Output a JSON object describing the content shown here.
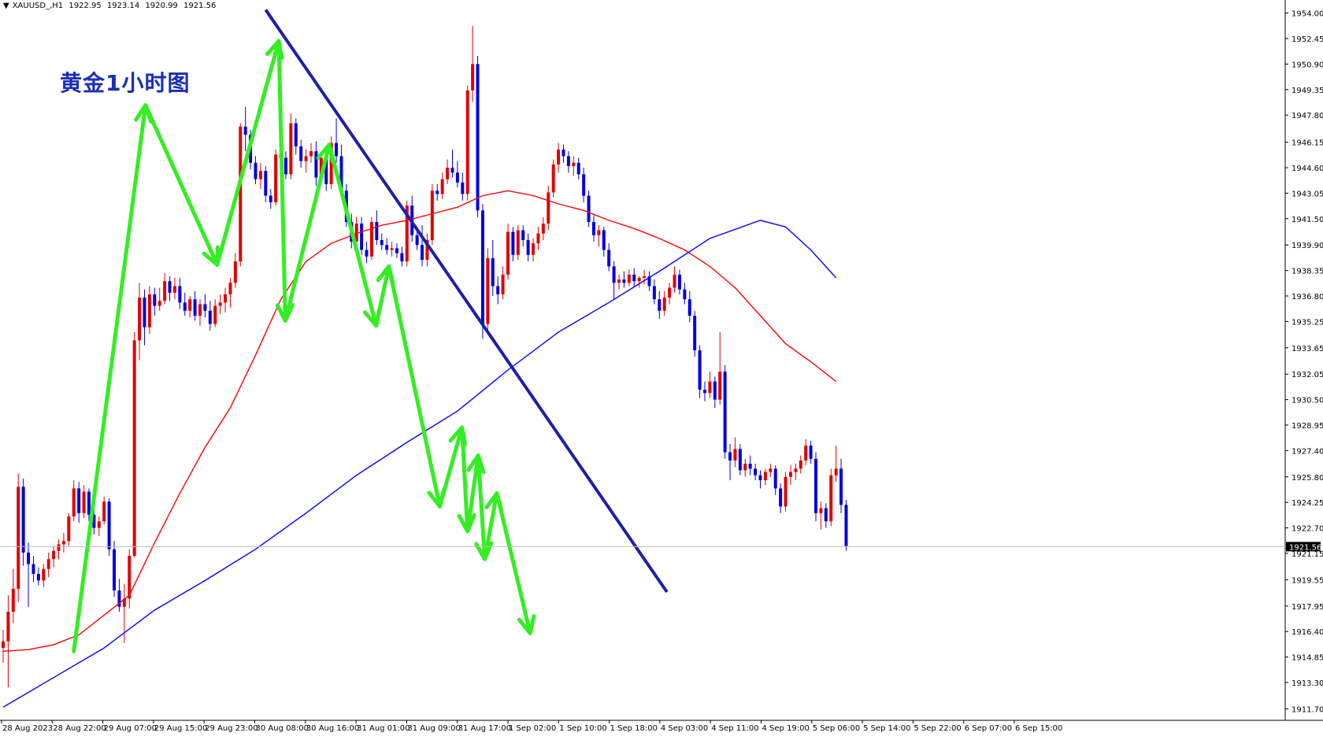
{
  "info_bar": {
    "symbol_timeframe": "XAUUSD_,H1",
    "open": "1922.95",
    "high": "1923.14",
    "low": "1920.99",
    "close": "1921.56"
  },
  "title": "黄金1小时图",
  "colors": {
    "bull_candle": "#e00000",
    "bear_candle": "#0000e0",
    "ma_fast": "#ff0000",
    "ma_slow": "#0000ff",
    "trendline": "#1f1faa",
    "arrows": "#33ee22"
  },
  "price_axis": {
    "ticks": [
      "1954.00",
      "1952.45",
      "1950.90",
      "1949.35",
      "1947.80",
      "1946.15",
      "1944.60",
      "1943.05",
      "1941.50",
      "1939.90",
      "1938.35",
      "1936.80",
      "1935.25",
      "1933.65",
      "1932.05",
      "1930.50",
      "1928.95",
      "1927.40",
      "1925.80",
      "1924.25",
      "1922.70",
      "1921.15",
      "1919.55",
      "1917.95",
      "1916.40",
      "1914.85",
      "1913.30",
      "1911.70"
    ],
    "current_price": "1921.56"
  },
  "time_axis": {
    "labels": [
      "28 Aug 2023",
      "28 Aug 22:00",
      "29 Aug 07:00",
      "29 Aug 15:00",
      "29 Aug 23:00",
      "30 Aug 08:00",
      "30 Aug 16:00",
      "31 Aug 01:00",
      "31 Aug 09:00",
      "31 Aug 17:00",
      "1 Sep 02:00",
      "1 Sep 10:00",
      "1 Sep 18:00",
      "4 Sep 03:00",
      "4 Sep 11:00",
      "4 Sep 19:00",
      "5 Sep 06:00",
      "5 Sep 14:00",
      "5 Sep 22:00",
      "6 Sep 07:00",
      "6 Sep 15:00"
    ]
  },
  "chart_data": {
    "type": "candlestick",
    "symbol": "XAUUSD_",
    "timeframe": "H1",
    "ylim": [
      1911.0,
      1954.7
    ],
    "grid": false,
    "candles": [
      [
        1915.4,
        1916.5,
        1914.5,
        1915.8
      ],
      [
        1915.8,
        1918.6,
        1913.0,
        1917.6
      ],
      [
        1917.6,
        1920.2,
        1916.9,
        1919.0
      ],
      [
        1919.0,
        1926.0,
        1918.2,
        1925.2
      ],
      [
        1925.2,
        1925.7,
        1920.4,
        1921.2
      ],
      [
        1921.2,
        1921.8,
        1917.9,
        1920.5
      ],
      [
        1920.5,
        1921.0,
        1919.4,
        1919.9
      ],
      [
        1919.9,
        1920.3,
        1919.2,
        1919.5
      ],
      [
        1919.5,
        1920.5,
        1919.1,
        1920.2
      ],
      [
        1920.2,
        1921.2,
        1919.7,
        1920.8
      ],
      [
        1920.8,
        1921.6,
        1920.3,
        1921.3
      ],
      [
        1921.3,
        1922.0,
        1920.8,
        1921.7
      ],
      [
        1921.7,
        1922.4,
        1921.2,
        1921.9
      ],
      [
        1921.9,
        1923.6,
        1921.6,
        1923.4
      ],
      [
        1923.4,
        1925.6,
        1923.1,
        1925.1
      ],
      [
        1925.1,
        1925.5,
        1923.0,
        1923.6
      ],
      [
        1923.6,
        1925.3,
        1923.3,
        1924.9
      ],
      [
        1924.9,
        1925.1,
        1923.1,
        1923.5
      ],
      [
        1923.5,
        1923.9,
        1922.3,
        1922.7
      ],
      [
        1922.7,
        1923.4,
        1922.2,
        1923.1
      ],
      [
        1923.1,
        1924.6,
        1922.9,
        1924.3
      ],
      [
        1924.3,
        1924.5,
        1921.0,
        1921.4
      ],
      [
        1921.4,
        1921.9,
        1918.5,
        1918.9
      ],
      [
        1918.9,
        1919.6,
        1917.6,
        1917.9
      ],
      [
        1917.9,
        1919.3,
        1915.7,
        1918.4
      ],
      [
        1918.4,
        1921.4,
        1917.8,
        1921.0
      ],
      [
        1921.0,
        1934.6,
        1920.9,
        1934.1
      ],
      [
        1934.1,
        1937.6,
        1932.9,
        1936.7
      ],
      [
        1936.7,
        1937.2,
        1933.8,
        1934.9
      ],
      [
        1934.9,
        1937.4,
        1934.5,
        1936.9
      ],
      [
        1936.9,
        1937.3,
        1935.6,
        1936.2
      ],
      [
        1936.2,
        1937.3,
        1935.9,
        1936.5
      ],
      [
        1936.5,
        1938.2,
        1936.3,
        1937.7
      ],
      [
        1937.7,
        1938.0,
        1936.5,
        1937.0
      ],
      [
        1937.0,
        1937.9,
        1936.6,
        1937.4
      ],
      [
        1937.4,
        1937.9,
        1936.0,
        1936.4
      ],
      [
        1936.4,
        1937.0,
        1935.6,
        1935.9
      ],
      [
        1935.9,
        1936.8,
        1935.5,
        1936.6
      ],
      [
        1936.6,
        1937.1,
        1935.3,
        1935.6
      ],
      [
        1935.6,
        1936.6,
        1935.0,
        1936.3
      ],
      [
        1936.3,
        1936.9,
        1935.5,
        1935.9
      ],
      [
        1935.9,
        1936.5,
        1934.7,
        1935.1
      ],
      [
        1935.1,
        1936.6,
        1934.9,
        1936.2
      ],
      [
        1936.2,
        1936.9,
        1935.7,
        1936.4
      ],
      [
        1936.4,
        1937.3,
        1935.8,
        1936.9
      ],
      [
        1936.9,
        1937.9,
        1936.1,
        1937.6
      ],
      [
        1937.6,
        1939.4,
        1937.3,
        1938.9
      ],
      [
        1938.9,
        1947.3,
        1938.6,
        1947.1
      ],
      [
        1947.1,
        1948.3,
        1945.6,
        1946.6
      ],
      [
        1946.6,
        1946.9,
        1944.5,
        1944.9
      ],
      [
        1944.9,
        1945.3,
        1943.6,
        1943.9
      ],
      [
        1943.9,
        1944.9,
        1943.3,
        1944.4
      ],
      [
        1944.4,
        1944.7,
        1942.5,
        1942.9
      ],
      [
        1942.9,
        1943.3,
        1942.1,
        1942.5
      ],
      [
        1942.5,
        1945.7,
        1942.3,
        1945.4
      ],
      [
        1945.4,
        1946.0,
        1944.9,
        1945.2
      ],
      [
        1945.2,
        1945.6,
        1943.9,
        1944.2
      ],
      [
        1944.2,
        1947.9,
        1943.9,
        1947.3
      ],
      [
        1947.3,
        1947.6,
        1945.4,
        1945.9
      ],
      [
        1945.9,
        1946.3,
        1944.6,
        1945.0
      ],
      [
        1945.0,
        1945.7,
        1944.3,
        1945.3
      ],
      [
        1945.3,
        1946.1,
        1944.9,
        1945.6
      ],
      [
        1945.6,
        1946.2,
        1943.5,
        1944.0
      ],
      [
        1944.0,
        1945.6,
        1943.7,
        1945.2
      ],
      [
        1945.2,
        1945.6,
        1943.2,
        1943.6
      ],
      [
        1943.6,
        1946.5,
        1943.3,
        1946.1
      ],
      [
        1946.1,
        1947.6,
        1944.9,
        1945.3
      ],
      [
        1945.3,
        1946.0,
        1942.9,
        1943.2
      ],
      [
        1943.2,
        1943.6,
        1941.0,
        1941.3
      ],
      [
        1941.3,
        1941.8,
        1939.7,
        1940.1
      ],
      [
        1940.1,
        1941.6,
        1939.6,
        1941.2
      ],
      [
        1941.2,
        1941.6,
        1939.3,
        1939.6
      ],
      [
        1939.6,
        1940.1,
        1938.8,
        1939.2
      ],
      [
        1939.2,
        1941.6,
        1939.0,
        1941.3
      ],
      [
        1941.3,
        1942.0,
        1939.9,
        1940.2
      ],
      [
        1940.2,
        1940.6,
        1939.6,
        1939.9
      ],
      [
        1939.9,
        1940.3,
        1939.3,
        1939.6
      ],
      [
        1939.6,
        1940.1,
        1939.2,
        1939.7
      ],
      [
        1939.7,
        1940.0,
        1939.1,
        1939.4
      ],
      [
        1939.4,
        1939.8,
        1938.6,
        1938.9
      ],
      [
        1938.9,
        1942.6,
        1938.6,
        1942.3
      ],
      [
        1942.3,
        1942.9,
        1940.1,
        1940.5
      ],
      [
        1940.5,
        1941.0,
        1939.6,
        1939.9
      ],
      [
        1939.9,
        1941.1,
        1938.6,
        1939.0
      ],
      [
        1939.0,
        1940.6,
        1938.6,
        1940.2
      ],
      [
        1940.2,
        1943.6,
        1939.9,
        1943.2
      ],
      [
        1943.2,
        1943.6,
        1942.6,
        1943.0
      ],
      [
        1943.0,
        1944.3,
        1942.7,
        1943.9
      ],
      [
        1943.9,
        1945.1,
        1943.6,
        1944.6
      ],
      [
        1944.6,
        1945.7,
        1944.0,
        1944.3
      ],
      [
        1944.3,
        1945.0,
        1943.4,
        1943.7
      ],
      [
        1943.7,
        1944.3,
        1942.6,
        1943.0
      ],
      [
        1943.0,
        1949.6,
        1942.6,
        1949.3
      ],
      [
        1949.3,
        1953.2,
        1948.6,
        1950.9
      ],
      [
        1950.9,
        1951.4,
        1941.6,
        1942.0
      ],
      [
        1942.0,
        1942.4,
        1934.2,
        1935.1
      ],
      [
        1935.1,
        1939.7,
        1934.5,
        1939.1
      ],
      [
        1939.1,
        1940.2,
        1936.8,
        1937.4
      ],
      [
        1937.4,
        1938.0,
        1936.3,
        1936.9
      ],
      [
        1936.9,
        1938.6,
        1936.6,
        1938.1
      ],
      [
        1938.1,
        1941.2,
        1937.8,
        1940.7
      ],
      [
        1940.7,
        1941.0,
        1938.9,
        1939.3
      ],
      [
        1939.3,
        1941.1,
        1939.0,
        1940.8
      ],
      [
        1940.8,
        1941.1,
        1939.8,
        1940.2
      ],
      [
        1940.2,
        1940.6,
        1938.9,
        1939.3
      ],
      [
        1939.3,
        1940.3,
        1938.9,
        1940.0
      ],
      [
        1940.0,
        1941.0,
        1939.6,
        1940.6
      ],
      [
        1940.6,
        1941.6,
        1940.2,
        1941.2
      ],
      [
        1941.2,
        1943.5,
        1940.8,
        1943.1
      ],
      [
        1943.1,
        1945.1,
        1942.8,
        1944.8
      ],
      [
        1944.8,
        1946.1,
        1944.3,
        1945.7
      ],
      [
        1945.7,
        1946.0,
        1944.9,
        1945.3
      ],
      [
        1945.3,
        1945.6,
        1944.3,
        1944.7
      ],
      [
        1944.7,
        1945.3,
        1944.1,
        1944.9
      ],
      [
        1944.9,
        1945.2,
        1943.9,
        1944.2
      ],
      [
        1944.2,
        1944.6,
        1942.5,
        1942.9
      ],
      [
        1942.9,
        1943.2,
        1941.0,
        1941.3
      ],
      [
        1941.3,
        1941.7,
        1940.1,
        1940.5
      ],
      [
        1940.5,
        1941.1,
        1939.8,
        1940.8
      ],
      [
        1940.8,
        1941.0,
        1939.2,
        1939.6
      ],
      [
        1939.6,
        1940.0,
        1938.3,
        1938.6
      ],
      [
        1938.6,
        1938.9,
        1936.6,
        1937.6
      ],
      [
        1937.6,
        1938.1,
        1937.2,
        1937.8
      ],
      [
        1937.8,
        1938.3,
        1937.3,
        1937.6
      ],
      [
        1937.6,
        1938.4,
        1937.4,
        1938.1
      ],
      [
        1938.1,
        1938.5,
        1937.4,
        1937.7
      ],
      [
        1937.7,
        1938.0,
        1937.3,
        1937.9
      ],
      [
        1937.9,
        1938.4,
        1937.5,
        1938.0
      ],
      [
        1938.0,
        1938.3,
        1937.1,
        1937.4
      ],
      [
        1937.4,
        1937.8,
        1936.3,
        1936.6
      ],
      [
        1936.6,
        1937.1,
        1935.4,
        1935.9
      ],
      [
        1935.9,
        1937.1,
        1935.6,
        1936.7
      ],
      [
        1936.7,
        1937.6,
        1936.3,
        1937.3
      ],
      [
        1937.3,
        1938.6,
        1937.0,
        1938.1
      ],
      [
        1938.1,
        1938.4,
        1936.9,
        1937.2
      ],
      [
        1937.2,
        1937.6,
        1936.3,
        1936.6
      ],
      [
        1936.6,
        1937.1,
        1935.2,
        1935.6
      ],
      [
        1935.6,
        1935.9,
        1933.1,
        1933.5
      ],
      [
        1933.5,
        1933.8,
        1930.6,
        1931.1
      ],
      [
        1931.1,
        1931.6,
        1930.4,
        1930.9
      ],
      [
        1930.9,
        1932.2,
        1930.6,
        1931.6
      ],
      [
        1931.6,
        1931.9,
        1930.0,
        1930.5
      ],
      [
        1930.5,
        1934.6,
        1930.2,
        1932.2
      ],
      [
        1932.2,
        1932.6,
        1926.9,
        1927.3
      ],
      [
        1927.3,
        1927.8,
        1925.6,
        1926.8
      ],
      [
        1926.8,
        1928.2,
        1926.4,
        1927.5
      ],
      [
        1927.5,
        1927.8,
        1925.9,
        1926.2
      ],
      [
        1926.2,
        1926.9,
        1925.8,
        1926.6
      ],
      [
        1926.6,
        1927.1,
        1925.9,
        1926.3
      ],
      [
        1926.3,
        1926.6,
        1925.6,
        1925.9
      ],
      [
        1925.9,
        1926.2,
        1925.1,
        1925.6
      ],
      [
        1925.6,
        1926.3,
        1925.3,
        1926.1
      ],
      [
        1926.1,
        1926.6,
        1925.8,
        1926.3
      ],
      [
        1926.3,
        1926.5,
        1924.7,
        1925.1
      ],
      [
        1925.1,
        1925.4,
        1923.6,
        1924.0
      ],
      [
        1924.0,
        1926.1,
        1923.7,
        1925.8
      ],
      [
        1925.8,
        1926.5,
        1925.3,
        1926.1
      ],
      [
        1926.1,
        1926.6,
        1925.6,
        1926.3
      ],
      [
        1926.3,
        1927.1,
        1926.0,
        1926.8
      ],
      [
        1926.8,
        1928.1,
        1926.5,
        1927.7
      ],
      [
        1927.7,
        1928.0,
        1926.6,
        1926.9
      ],
      [
        1926.9,
        1927.3,
        1923.1,
        1923.6
      ],
      [
        1923.6,
        1924.3,
        1922.6,
        1923.9
      ],
      [
        1923.9,
        1924.2,
        1922.7,
        1923.1
      ],
      [
        1923.1,
        1926.3,
        1922.8,
        1925.9
      ],
      [
        1925.9,
        1927.7,
        1925.5,
        1926.3
      ],
      [
        1926.3,
        1926.9,
        1923.6,
        1924.1
      ],
      [
        1924.1,
        1924.4,
        1921.3,
        1921.6
      ]
    ],
    "moving_averages": [
      {
        "color": "red",
        "x_index": [
          0,
          5,
          10,
          15,
          20,
          25,
          30,
          35,
          40,
          45,
          50,
          55,
          60,
          65,
          70,
          75,
          80,
          85,
          90,
          95,
          100,
          105,
          110,
          115,
          120,
          125,
          130,
          135,
          140,
          145,
          150,
          155,
          160,
          165
        ],
        "values": [
          1915.2,
          1915.3,
          1915.6,
          1916.2,
          1917.4,
          1918.6,
          1921.8,
          1924.8,
          1927.6,
          1930.0,
          1933.2,
          1936.6,
          1938.9,
          1940.0,
          1940.6,
          1941.1,
          1941.4,
          1941.8,
          1942.2,
          1942.9,
          1943.2,
          1942.9,
          1942.4,
          1942.0,
          1941.4,
          1940.9,
          1940.3,
          1939.6,
          1938.6,
          1937.3,
          1935.6,
          1933.9,
          1932.8,
          1931.6
        ]
      },
      {
        "color": "blue",
        "x_index": [
          0,
          10,
          20,
          30,
          40,
          50,
          60,
          70,
          80,
          90,
          100,
          110,
          120,
          130,
          140,
          150,
          155,
          160,
          165
        ],
        "values": [
          1911.8,
          1913.6,
          1915.4,
          1917.7,
          1919.5,
          1921.4,
          1923.6,
          1925.9,
          1927.9,
          1929.8,
          1932.3,
          1934.6,
          1936.4,
          1938.3,
          1940.3,
          1941.4,
          1941.0,
          1939.6,
          1937.9
        ]
      }
    ],
    "trendline": {
      "from": [
        52,
        1954.2
      ],
      "to": [
        131.5,
        1918.8
      ]
    },
    "arrows_zigzag": [
      [
        14,
        1915.2
      ],
      [
        28.2,
        1948.4
      ],
      [
        42.4,
        1938.7
      ],
      [
        54.6,
        1952.3
      ],
      [
        55.9,
        1935.3
      ],
      [
        64.6,
        1946.0
      ],
      [
        73.9,
        1935.0
      ],
      [
        76.4,
        1938.6
      ],
      [
        86.5,
        1924.0
      ],
      [
        90.9,
        1928.8
      ],
      [
        92.0,
        1922.5
      ],
      [
        94.1,
        1927.1
      ],
      [
        95.4,
        1920.8
      ],
      [
        97.8,
        1924.8
      ],
      [
        104.4,
        1916.3
      ]
    ]
  }
}
